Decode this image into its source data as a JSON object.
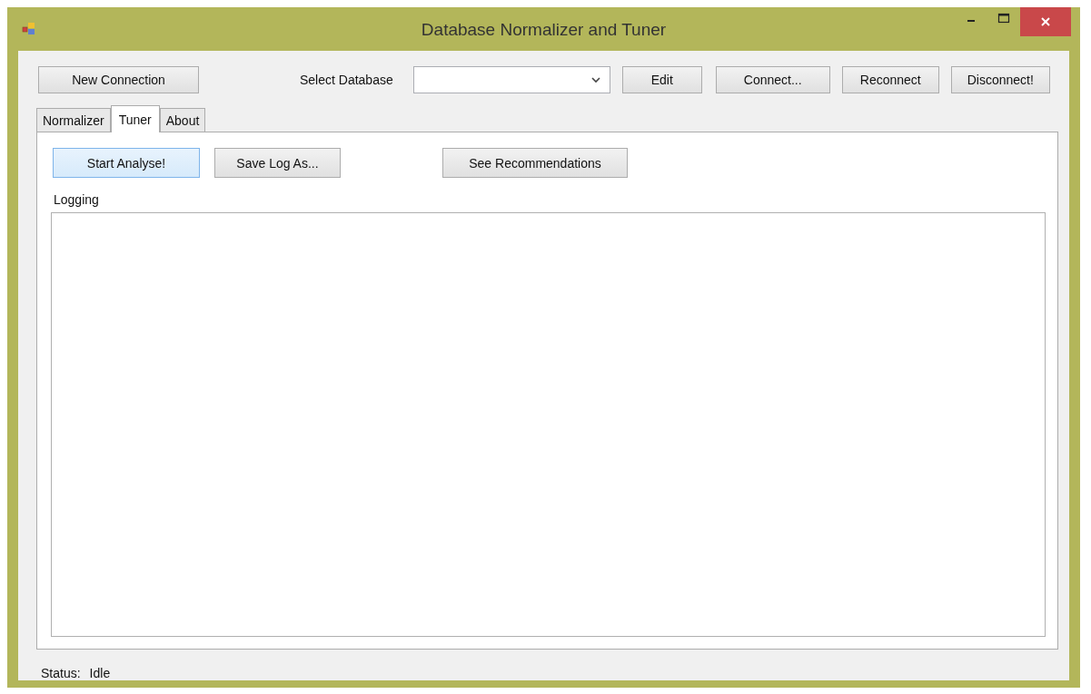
{
  "window": {
    "title": "Database Normalizer and Tuner"
  },
  "toolbar": {
    "new_connection": "New Connection",
    "select_label": "Select Database",
    "buttons": [
      {
        "label": "Edit"
      },
      {
        "label": "Connect..."
      },
      {
        "label": "Reconnect"
      },
      {
        "label": "Disconnect!"
      }
    ]
  },
  "tabs": [
    {
      "label": "Normalizer",
      "selected": false
    },
    {
      "label": "Tuner",
      "selected": true
    },
    {
      "label": "About",
      "selected": false
    }
  ],
  "tuner": {
    "buttons": [
      {
        "label": "Start Analyse!",
        "highlighted": true
      },
      {
        "label": "Save Log As...",
        "highlighted": false
      },
      {
        "label": "See Recommendations",
        "highlighted": false
      }
    ],
    "log_label": "Logging"
  },
  "status_bar": {
    "label": "Status:",
    "value": "Idle"
  }
}
